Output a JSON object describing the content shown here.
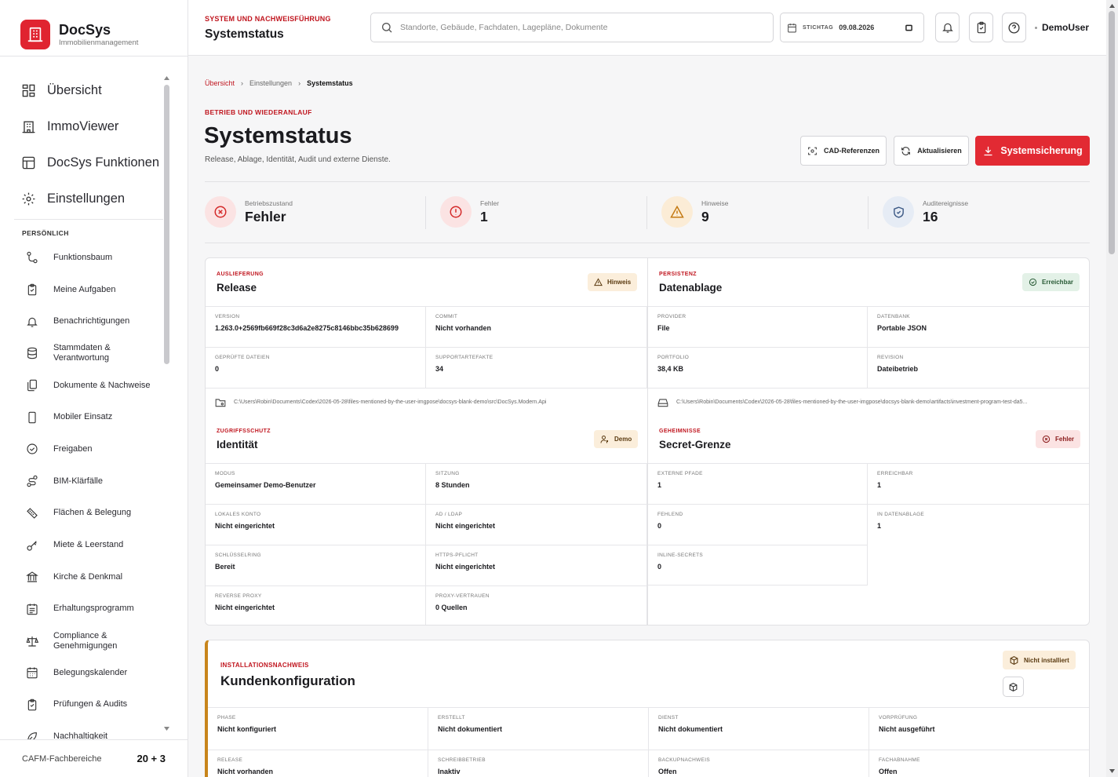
{
  "app": {
    "name": "DocSys",
    "subtitle": "Immobilienmanagement"
  },
  "nav_main": [
    {
      "label": "Übersicht",
      "icon": "dashboard-icon"
    },
    {
      "label": "ImmoViewer",
      "icon": "building-icon"
    },
    {
      "label": "DocSys Funktionen",
      "icon": "layout-icon"
    },
    {
      "label": "Einstellungen",
      "icon": "gear-icon"
    }
  ],
  "personal_heading": "PERSÖNLICH",
  "nav_personal": [
    {
      "label": "Funktionsbaum",
      "icon": "tree-icon"
    },
    {
      "label": "Meine Aufgaben",
      "icon": "clipboard-icon"
    },
    {
      "label": "Benachrichtigungen",
      "icon": "bell-icon"
    },
    {
      "label": "Stammdaten & Verantwortung",
      "icon": "database-icon"
    },
    {
      "label": "Dokumente & Nachweise",
      "icon": "documents-icon"
    },
    {
      "label": "Mobiler Einsatz",
      "icon": "mobile-icon"
    },
    {
      "label": "Freigaben",
      "icon": "check-circle-icon"
    },
    {
      "label": "BIM-Klärfälle",
      "icon": "route-icon"
    },
    {
      "label": "Flächen & Belegung",
      "icon": "ruler-icon"
    },
    {
      "label": "Miete & Leerstand",
      "icon": "key-icon"
    },
    {
      "label": "Kirche & Denkmal",
      "icon": "landmark-icon"
    },
    {
      "label": "Erhaltungsprogramm",
      "icon": "calendar-list-icon"
    },
    {
      "label": "Compliance & Genehmigungen",
      "icon": "scale-icon"
    },
    {
      "label": "Belegungskalender",
      "icon": "calendar-icon"
    },
    {
      "label": "Prüfungen & Audits",
      "icon": "clipboard-check-icon"
    },
    {
      "label": "Nachhaltigkeit",
      "icon": "leaf-icon"
    }
  ],
  "sidebar_footer": {
    "label": "CAFM-Fachbereiche",
    "count": "20 + 3"
  },
  "topbar": {
    "kicker": "SYSTEM UND NACHWEISFÜHRUNG",
    "title": "Systemstatus",
    "search_placeholder": "Standorte, Gebäude, Fachdaten, Lagepläne, Dokumente",
    "date_label": "STICHTAG",
    "date_value": "09.08.2026",
    "user": "DemoUser"
  },
  "breadcrumb": [
    "Übersicht",
    "Einstellungen",
    "Systemstatus"
  ],
  "page": {
    "kicker": "BETRIEB UND WIEDERANLAUF",
    "title": "Systemstatus",
    "subtitle": "Release, Ablage, Identität, Audit und externe Dienste."
  },
  "actions": {
    "cad": "CAD-Referenzen",
    "refresh": "Aktualisieren",
    "backup": "Systemsicherung"
  },
  "stats": [
    {
      "label": "Betriebszustand",
      "value": "Fehler"
    },
    {
      "label": "Fehler",
      "value": "1"
    },
    {
      "label": "Hinweise",
      "value": "9"
    },
    {
      "label": "Auditereignisse",
      "value": "16"
    }
  ],
  "release": {
    "kicker": "AUSLIEFERUNG",
    "title": "Release",
    "badge": "Hinweis",
    "fields": [
      {
        "label": "VERSION",
        "value": "1.263.0+2569fb669f28c3d6a2e8275c8146bbc35b628699"
      },
      {
        "label": "COMMIT",
        "value": "Nicht vorhanden"
      },
      {
        "label": "GEPRÜFTE DATEIEN",
        "value": "0"
      },
      {
        "label": "SUPPORTARTEFAKTE",
        "value": "34"
      }
    ],
    "path": "C:\\Users\\Robin\\Documents\\Codex\\2026-05-28\\files-mentioned-by-the-user-imgpose\\docsys-blank-demo\\src\\DocSys.Modern.Api"
  },
  "storage": {
    "kicker": "PERSISTENZ",
    "title": "Datenablage",
    "badge": "Erreichbar",
    "fields": [
      {
        "label": "PROVIDER",
        "value": "File"
      },
      {
        "label": "DATENBANK",
        "value": "Portable JSON"
      },
      {
        "label": "PORTFOLIO",
        "value": "38,4 KB"
      },
      {
        "label": "REVISION",
        "value": "Dateibetrieb"
      }
    ],
    "path": "C:\\Users\\Robin\\Documents\\Codex\\2026-05-28\\files-mentioned-by-the-user-imgpose\\docsys-blank-demo\\artifacts\\investment-program-test-da5..."
  },
  "identity": {
    "kicker": "ZUGRIFFSSCHUTZ",
    "title": "Identität",
    "badge": "Demo",
    "fields": [
      {
        "label": "MODUS",
        "value": "Gemeinsamer Demo-Benutzer"
      },
      {
        "label": "SITZUNG",
        "value": "8 Stunden"
      },
      {
        "label": "LOKALES KONTO",
        "value": "Nicht eingerichtet"
      },
      {
        "label": "AD / LDAP",
        "value": "Nicht eingerichtet"
      },
      {
        "label": "SCHLÜSSELRING",
        "value": "Bereit"
      },
      {
        "label": "HTTPS-PFLICHT",
        "value": "Nicht eingerichtet"
      },
      {
        "label": "REVERSE PROXY",
        "value": "Nicht eingerichtet"
      },
      {
        "label": "PROXY-VERTRAUEN",
        "value": "0 Quellen"
      }
    ]
  },
  "secrets": {
    "kicker": "GEHEIMNISSE",
    "title": "Secret-Grenze",
    "badge": "Fehler",
    "fields": [
      {
        "label": "EXTERNE PFADE",
        "value": "1"
      },
      {
        "label": "ERREICHBAR",
        "value": "1"
      },
      {
        "label": "FEHLEND",
        "value": "0"
      },
      {
        "label": "IN DATENABLAGE",
        "value": "1"
      },
      {
        "label": "INLINE-SECRETS",
        "value": "0"
      }
    ]
  },
  "installation": {
    "kicker": "INSTALLATIONSNACHWEIS",
    "title": "Kundenkonfiguration",
    "badge": "Nicht installiert",
    "fields": [
      {
        "label": "PHASE",
        "value": "Nicht konfiguriert"
      },
      {
        "label": "ERSTELLT",
        "value": "Nicht dokumentiert"
      },
      {
        "label": "DIENST",
        "value": "Nicht dokumentiert"
      },
      {
        "label": "VORPRÜFUNG",
        "value": "Nicht ausgeführt"
      },
      {
        "label": "RELEASE",
        "value": "Nicht vorhanden"
      },
      {
        "label": "SCHREIBBETRIEB",
        "value": "Inaktiv"
      },
      {
        "label": "BACKUPNACHWEIS",
        "value": "Offen"
      },
      {
        "label": "FACHABNAHME",
        "value": "Offen"
      }
    ]
  },
  "colors": {
    "accent": "#e22a33",
    "error": "#d42a2a",
    "warning": "#e39a2a",
    "info": "#3d5a86"
  }
}
